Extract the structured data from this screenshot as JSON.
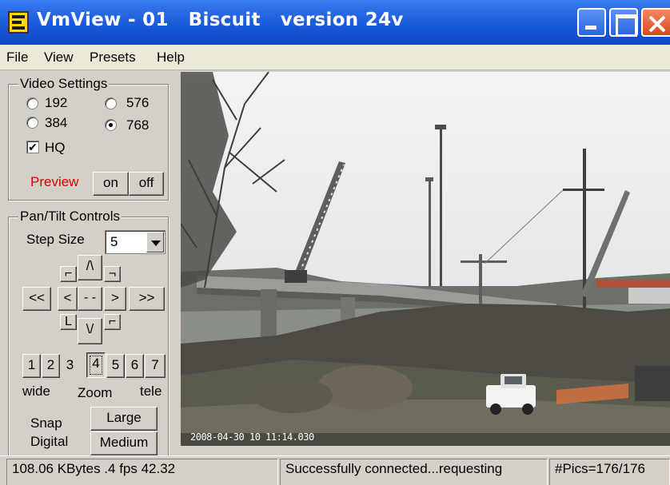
{
  "window": {
    "title": "VmView - 01   Biscuit   version 24v",
    "icon": "app-e-icon"
  },
  "menu": [
    "File",
    "View",
    "Presets",
    "Help"
  ],
  "video_settings": {
    "legend": "Video Settings",
    "options": [
      {
        "label": "192",
        "selected": false
      },
      {
        "label": "576",
        "selected": false
      },
      {
        "label": "384",
        "selected": false
      },
      {
        "label": "768",
        "selected": true
      }
    ],
    "hq_label": "HQ",
    "hq_checked": true,
    "check_mark": "✔",
    "preview_label": "Preview",
    "on_label": "on",
    "off_label": "off"
  },
  "pantilt": {
    "legend": "Pan/Tilt Controls",
    "step_size_label": "Step Size",
    "step_size_value": "5",
    "up_label": "/\\",
    "down_label": "\\/",
    "left_fast": "<<",
    "left": "<",
    "center": "- -",
    "right": ">",
    "right_fast": ">>",
    "corner_tl": "⌐",
    "corner_tr": "¬",
    "corner_bl": "L",
    "corner_br": "⌐",
    "zoom_levels": [
      "1",
      "2",
      "3",
      "4",
      "5",
      "6",
      "7"
    ],
    "zoom_selected": "4",
    "wide_label": "wide",
    "zoom_label": "Zoom",
    "tele_label": "tele",
    "snap_label": "Snap",
    "digital_label": "Digital",
    "large_label": "Large",
    "medium_label": "Medium"
  },
  "video": {
    "timestamp": "2008-04-30  10 11:14.030"
  },
  "status": {
    "pane1": "108.06 KBytes .4 fps  42.32",
    "pane2": "Successfully connected...requesting",
    "pane3": "#Pics=176/176"
  },
  "colors": {
    "titlebar": "#0a46c8",
    "preview_text": "#d40000",
    "close_button": "#d8481e"
  }
}
